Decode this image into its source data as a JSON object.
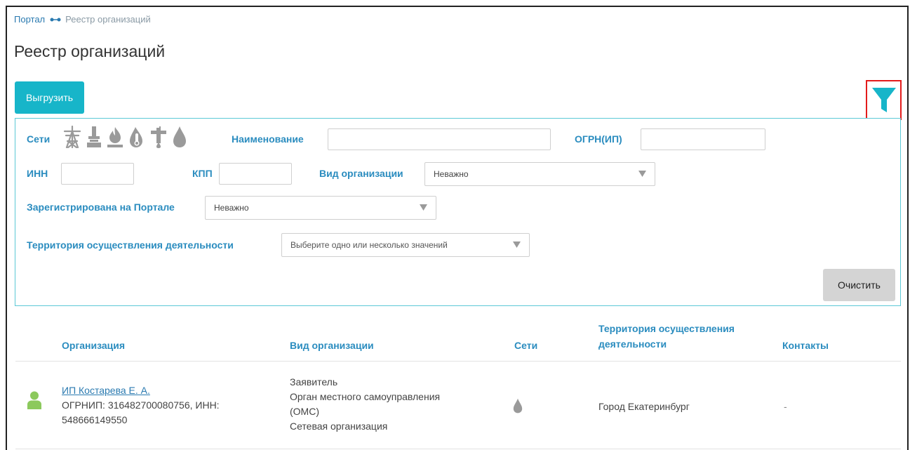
{
  "breadcrumb": {
    "home": "Портал",
    "current": "Реестр организаций"
  },
  "page_title": "Реестр организаций",
  "toolbar": {
    "export_label": "Выгрузить"
  },
  "filters": {
    "networks_label": "Сети",
    "network_icons": [
      "power-line-icon",
      "heat-pipe-icon",
      "gas-icon",
      "hot-water-icon",
      "sewerage-icon",
      "water-icon"
    ],
    "name_label": "Наименование",
    "name_value": "",
    "ogrn_label": "ОГРН(ИП)",
    "ogrn_value": "",
    "inn_label": "ИНН",
    "inn_value": "",
    "kpp_label": "КПП",
    "kpp_value": "",
    "org_type_label": "Вид организации",
    "org_type_value": "Неважно",
    "registered_label": "Зарегистрирована на Портале",
    "registered_value": "Неважно",
    "territory_label": "Территория осуществления деятельности",
    "territory_placeholder": "Выберите одно или несколько значений",
    "clear_label": "Очистить"
  },
  "table": {
    "columns": {
      "organization": "Организация",
      "org_type": "Вид организации",
      "networks": "Сети",
      "territory_line1": "Территория осуществления",
      "territory_line2": "деятельности",
      "contacts": "Контакты"
    },
    "rows": [
      {
        "name": "ИП Костарева Е. А.",
        "details_line1": "ОГРНИП: 316482700080756, ИНН:",
        "details_line2": "548666149550",
        "org_types": [
          "Заявитель",
          "Орган местного самоуправления",
          "(ОМС)",
          "Сетевая организация"
        ],
        "network_icon": "water-icon",
        "territory": "Город Екатеринбург",
        "contacts": "-",
        "status_icon": "user-icon",
        "status_color": "#8cc95d"
      }
    ]
  },
  "colors": {
    "accent": "#17b5c9",
    "label": "#2a8cbf",
    "highlight": "#e31b1b",
    "icon_gray": "#9a9a9a"
  }
}
